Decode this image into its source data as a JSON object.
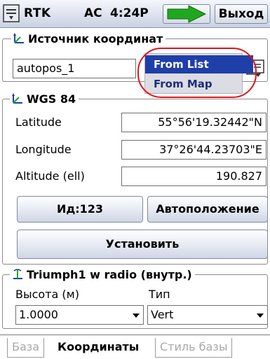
{
  "titlebar": {
    "app_title": "RTK",
    "ac_status": "AC",
    "time": "4:24P",
    "exit_label": "Выход"
  },
  "source_group": {
    "title": "Источник координат",
    "value": "autopos_1",
    "menu": {
      "items": [
        "From List",
        "From Map"
      ],
      "selected_index": 0
    }
  },
  "wgs_group": {
    "title": "WGS 84",
    "latitude_label": "Latitude",
    "latitude_value": "55°56'19.32442\"N",
    "longitude_label": "Longitude",
    "longitude_value": "37°26'44.23703\"E",
    "altitude_label": "Altitude (ell)",
    "altitude_value": "190.827",
    "id_button": "Ид:123",
    "autopos_button": "Автоположение",
    "set_button": "Установить"
  },
  "antenna_group": {
    "title": "Triumph1 w radio (внутр.)",
    "height_label": "Высота (м)",
    "height_value": "1.0000",
    "type_label": "Тип",
    "type_value": "Vert"
  },
  "tabs": [
    {
      "label": "База",
      "active": false
    },
    {
      "label": "Координаты",
      "active": true
    },
    {
      "label": "Стиль базы",
      "active": false
    }
  ],
  "colors": {
    "accent_arrow": "#1fa81f",
    "menu_selected": "#1f3fa8",
    "highlight_ring": "#e0141a"
  }
}
